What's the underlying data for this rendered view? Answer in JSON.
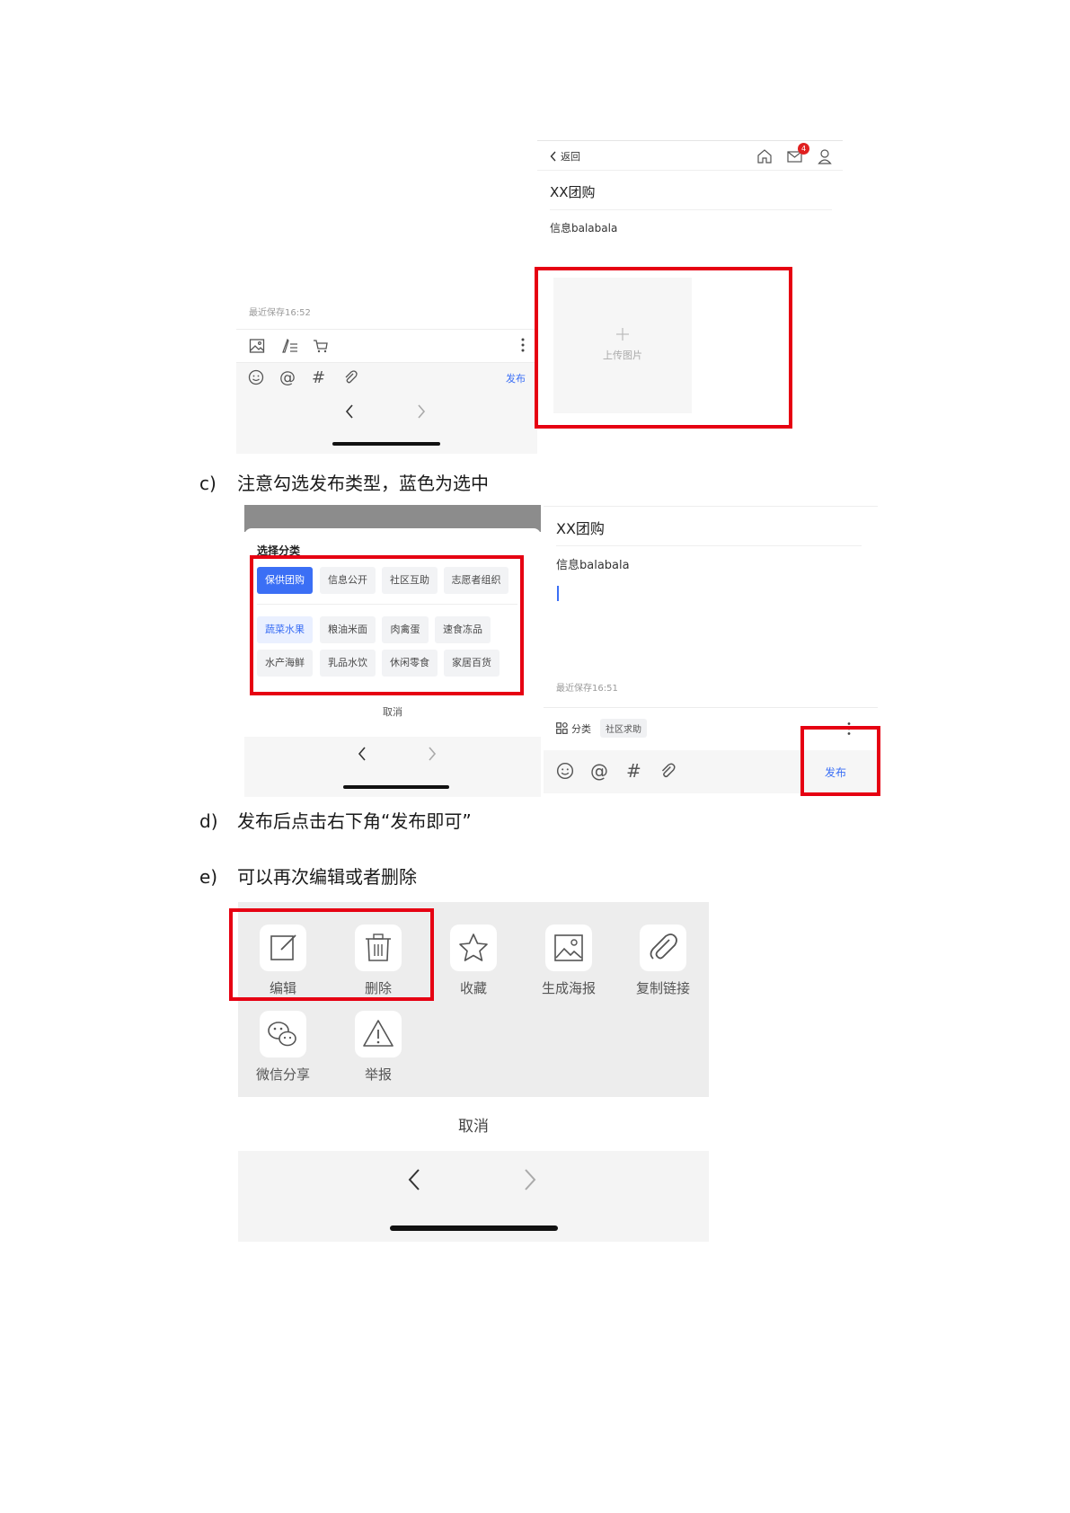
{
  "figure1": {
    "left": {
      "save_status": "最近保存16:52",
      "publish_label": "发布"
    },
    "right": {
      "back_label": "返回",
      "notification_count": "4",
      "post_title": "XX团购",
      "post_body": "信息balabala",
      "upload_label": "上传图片"
    }
  },
  "captions": {
    "c": {
      "label": "c)",
      "text": "注意勾选发布类型，蓝色为选中"
    },
    "d": {
      "label": "d)",
      "text": "发布后点击右下角“发布即可”"
    },
    "e": {
      "label": "e)",
      "text": "可以再次编辑或者删除"
    }
  },
  "figure2": {
    "left": {
      "sheet_title": "选择分类",
      "type_chips": [
        "保供团购",
        "信息公开",
        "社区互助",
        "志愿者组织"
      ],
      "selected_type": "保供团购",
      "sub_chips_row1": [
        "蔬菜水果",
        "粮油米面",
        "肉禽蛋",
        "速食冻品"
      ],
      "sub_chips_row2": [
        "水产海鲜",
        "乳品水饮",
        "休闲零食",
        "家居百货"
      ],
      "cancel_label": "取消"
    },
    "right": {
      "post_title": "XX团购",
      "post_body": "信息balabala",
      "save_status": "最近保存16:51",
      "category_label": "分类",
      "category_value": "社区求助",
      "publish_label": "发布"
    }
  },
  "figure3": {
    "actions_row1": [
      "编辑",
      "删除",
      "收藏",
      "生成海报",
      "复制链接"
    ],
    "actions_row2": [
      "微信分享",
      "举报"
    ],
    "cancel_label": "取消"
  },
  "colors": {
    "highlight": "#e60012",
    "accent_blue": "#3b6ff5"
  }
}
